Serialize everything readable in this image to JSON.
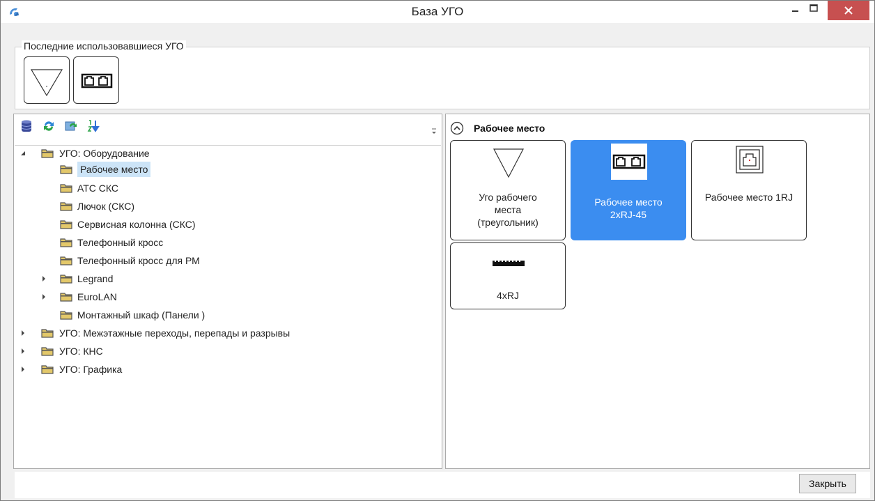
{
  "window": {
    "title": "База УГО"
  },
  "recent": {
    "legend": "Последние использовавшиеся УГО",
    "items": [
      {
        "icon": "triangle-symbol-icon"
      },
      {
        "icon": "double-rj45-symbol-icon"
      }
    ]
  },
  "toolbar": {
    "icons": [
      "database-icon",
      "refresh-icon",
      "sync-icon",
      "sort-icon"
    ]
  },
  "tree": {
    "nodes": [
      {
        "label": "УГО: Оборудование",
        "expanded": true
      },
      {
        "label": "Рабочее место",
        "selected": true
      },
      {
        "label": "АТС СКС"
      },
      {
        "label": "Лючок (СКС)"
      },
      {
        "label": "Сервисная колонна (СКС)"
      },
      {
        "label": "Телефонный кросс"
      },
      {
        "label": "Телефонный кросс для РМ"
      },
      {
        "label": "Legrand",
        "collapsed": true
      },
      {
        "label": "EuroLAN",
        "collapsed": true
      },
      {
        "label": "Монтажный шкаф (Панели )"
      },
      {
        "label": "УГО: Межэтажные переходы, перепады и разрывы",
        "collapsed": true
      },
      {
        "label": "УГО: КНС",
        "collapsed": true
      },
      {
        "label": "УГО: Графика",
        "collapsed": true
      }
    ]
  },
  "gallery": {
    "group_title": "Рабочее место",
    "tiles": [
      {
        "label_lines": [
          "Уго рабочего",
          "места",
          "(треугольник)"
        ],
        "icon": "triangle-symbol-icon"
      },
      {
        "label_lines": [
          "Рабочее место",
          "2xRJ-45"
        ],
        "icon": "double-rj45-symbol-icon",
        "selected": true
      },
      {
        "label_lines": [
          "Рабочее место 1RJ"
        ],
        "icon": "single-rj-symbol-icon"
      },
      {
        "label_lines": [
          "4xRJ"
        ],
        "icon": "quad-rj-symbol-icon"
      }
    ]
  },
  "footer": {
    "close_label": "Закрыть"
  },
  "colors": {
    "selection": "#3b8df0",
    "tree_selection": "#cce4f7",
    "close_button": "#c75050"
  }
}
